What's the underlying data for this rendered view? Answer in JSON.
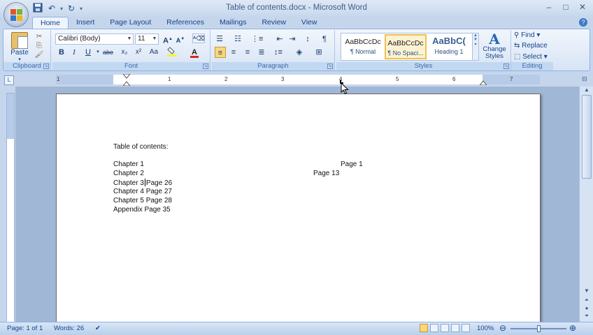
{
  "window": {
    "title": "Table of contents.docx - Microsoft Word",
    "controls": [
      "–",
      "□",
      "✕"
    ]
  },
  "qat": {
    "save_icon": "save-icon",
    "undo_icon": "undo-icon",
    "redo_icon": "redo-icon"
  },
  "tabs": [
    "Home",
    "Insert",
    "Page Layout",
    "References",
    "Mailings",
    "Review",
    "View"
  ],
  "active_tab": "Home",
  "ribbon": {
    "clipboard": {
      "label": "Clipboard",
      "paste": "Paste"
    },
    "font": {
      "label": "Font",
      "font_name": "Calibri (Body)",
      "font_size": "11",
      "buttons": [
        "B",
        "I",
        "U",
        "abe",
        "x₂",
        "x²",
        "Aa"
      ]
    },
    "paragraph": {
      "label": "Paragraph"
    },
    "styles": {
      "label": "Styles",
      "items": [
        {
          "sample": "AaBbCcDc",
          "name": "¶ Normal"
        },
        {
          "sample": "AaBbCcDc",
          "name": "¶ No Spaci..."
        },
        {
          "sample": "AaBbC(",
          "name": "Heading 1"
        }
      ],
      "change_styles": "Change Styles"
    },
    "editing": {
      "label": "Editing",
      "find": "Find",
      "replace": "Replace",
      "select": "Select"
    }
  },
  "ruler": {
    "numbers": [
      "1",
      "1",
      "2",
      "3",
      "4",
      "5",
      "6",
      "7"
    ]
  },
  "document": {
    "heading": "Table of contents:",
    "lines": [
      {
        "left": "Chapter 1",
        "right": "Page 1"
      },
      {
        "left": "Chapter 2",
        "right": "Page 13"
      },
      {
        "left": "Chapter 3",
        "right": "Page 26"
      },
      {
        "left": "Chapter 4",
        "right": "Page 27"
      },
      {
        "left": "Chapter 5",
        "right": "Page 28"
      },
      {
        "left": "Appendix",
        "right": "Page 35"
      }
    ]
  },
  "status": {
    "page": "Page: 1 of 1",
    "words": "Words: 26",
    "zoom": "100%"
  }
}
